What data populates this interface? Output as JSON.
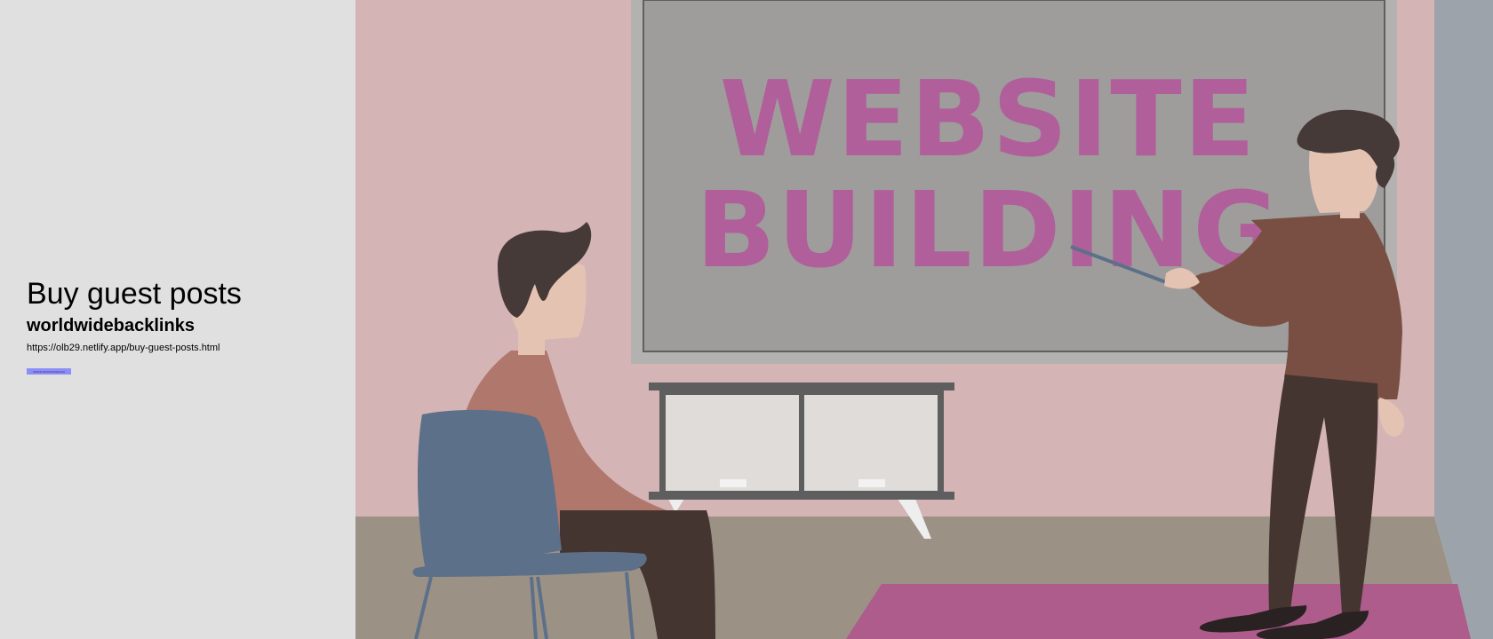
{
  "sidebar": {
    "title": "Buy guest posts",
    "subtitle": "worldwidebacklinks",
    "url": "https://olb29.netlify.app/buy-guest-posts.html",
    "button_label": "ussuuuussussssuuu"
  },
  "hero": {
    "board_text_line1": "WEBSITE",
    "board_text_line2": "BUILDING"
  },
  "colors": {
    "sidebar_bg": "#e0e0e0",
    "wall": "#d4b4b5",
    "board": "#9e9d9b",
    "board_text": "#b05f9b",
    "floor": "#9c9185",
    "rug": "#ad5c8b",
    "chair": "#5c7089",
    "button": "#8c8ef7"
  }
}
